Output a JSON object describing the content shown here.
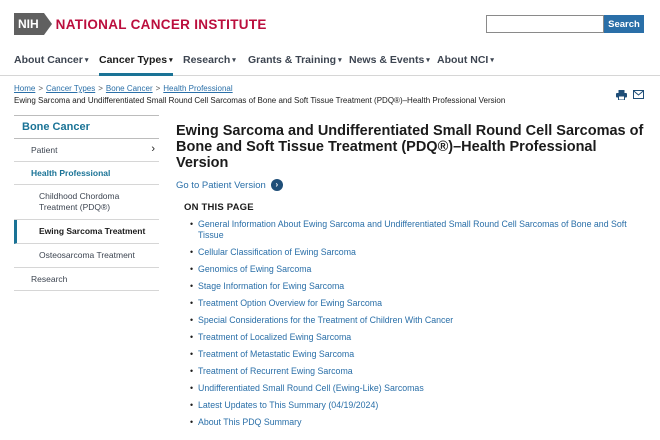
{
  "header": {
    "logo_badge": "NIH",
    "logo_text": "NATIONAL CANCER INSTITUTE",
    "search_placeholder": "",
    "search_button": "Search"
  },
  "nav": {
    "items": [
      {
        "label": "About Cancer",
        "caret": "▾"
      },
      {
        "label": "Cancer Types",
        "caret": "▾"
      },
      {
        "label": "Research",
        "caret": "▾"
      },
      {
        "label": "Grants & Training",
        "caret": "▾"
      },
      {
        "label": "News & Events",
        "caret": "▾"
      },
      {
        "label": "About NCI",
        "caret": "▾"
      }
    ]
  },
  "breadcrumb": {
    "links": [
      "Home",
      "Cancer Types",
      "Bone Cancer",
      "Health Professional"
    ],
    "separator": ">",
    "current": "Ewing Sarcoma and Undifferentiated Small Round Cell Sarcomas of Bone and Soft Tissue Treatment (PDQ®)–Health Professional Version"
  },
  "utility_icons": [
    "print-icon",
    "email-icon"
  ],
  "sidebar": {
    "title": "Bone Cancer",
    "items": [
      {
        "label": "Patient",
        "chevron": "›"
      },
      {
        "label": "Health Professional"
      },
      {
        "label": "Childhood Chordoma Treatment (PDQ®)"
      },
      {
        "label": "Ewing Sarcoma Treatment"
      },
      {
        "label": "Osteosarcoma Treatment"
      },
      {
        "label": "Research"
      }
    ]
  },
  "main": {
    "title": "Ewing Sarcoma and Undifferentiated Small Round Cell Sarcomas of Bone and Soft Tissue Treatment (PDQ®)–Health Professional Version",
    "patient_link": "Go to Patient Version",
    "on_this_page": "ON THIS PAGE",
    "toc": [
      "General Information About Ewing Sarcoma and Undifferentiated Small Round Cell Sarcomas of Bone and Soft Tissue",
      "Cellular Classification of Ewing Sarcoma",
      "Genomics of Ewing Sarcoma",
      "Stage Information for Ewing Sarcoma",
      "Treatment Option Overview for Ewing Sarcoma",
      "Special Considerations for the Treatment of Children With Cancer",
      "Treatment of Localized Ewing Sarcoma",
      "Treatment of Metastatic Ewing Sarcoma",
      "Treatment of Recurrent Ewing Sarcoma",
      "Undifferentiated Small Round Cell (Ewing-Like) Sarcomas",
      "Latest Updates to This Summary (04/19/2024)",
      "About This PDQ Summary"
    ]
  },
  "colors": {
    "brand_red": "#bb0e3d",
    "link_blue": "#2a6fa8",
    "teal": "#1a7396",
    "nih_gray": "#606060"
  }
}
